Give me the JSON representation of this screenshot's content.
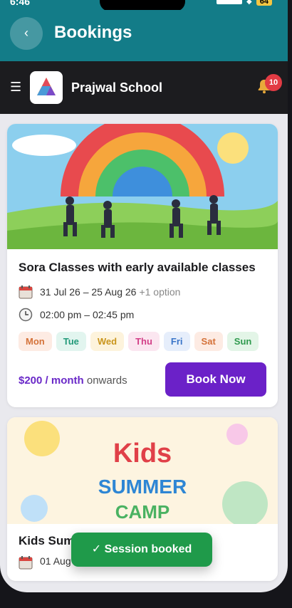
{
  "status": {
    "time": "6:46",
    "battery": "64"
  },
  "header": {
    "title": "Bookings",
    "back_icon": "chevron-left-icon"
  },
  "school": {
    "name": "Prajwal School",
    "notification_count": "10"
  },
  "card1": {
    "title": "Sora Classes with early available classes",
    "dates": "31 Jul 26 – 25 Aug 26",
    "dates_extra": "+1 option",
    "time": "02:00 pm – 02:45 pm",
    "days": [
      {
        "label": "Mon",
        "color": "#d4723a",
        "bg": "#fdebe3"
      },
      {
        "label": "Tue",
        "color": "#239a7a",
        "bg": "#e2f5ef"
      },
      {
        "label": "Wed",
        "color": "#c9951d",
        "bg": "#fdf3dc"
      },
      {
        "label": "Thu",
        "color": "#d23f87",
        "bg": "#fbe6f0"
      },
      {
        "label": "Fri",
        "color": "#3b76c8",
        "bg": "#e6eefb"
      },
      {
        "label": "Sat",
        "color": "#d4723a",
        "bg": "#fdebe3"
      },
      {
        "label": "Sun",
        "color": "#2f9a4e",
        "bg": "#e3f5e7"
      }
    ],
    "price_amount": "$200 / month",
    "price_suffix": " onwards",
    "book_label": "Book Now"
  },
  "card2": {
    "banner_line1": "Kids",
    "banner_line2": "SUMMER",
    "banner_line3": "CAMP",
    "title_partial": "Kids Sum",
    "date_partial": "01 Aug"
  },
  "toast": {
    "message": "✓ Session booked"
  },
  "colors": {
    "teal": "#137c88",
    "purple": "#6b21c8",
    "toast_green": "#1f9a4a"
  }
}
